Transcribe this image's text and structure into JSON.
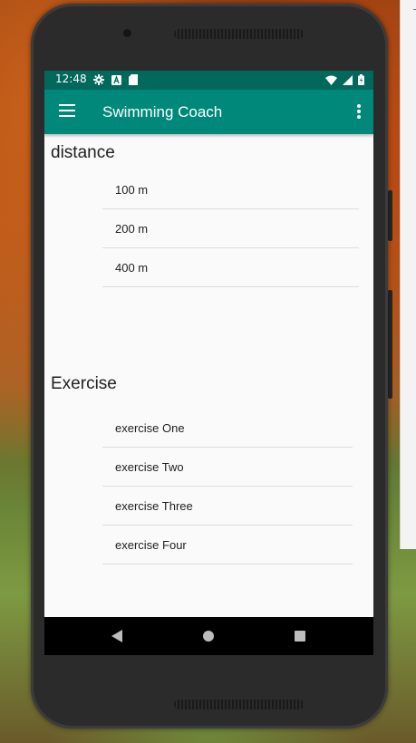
{
  "status_bar": {
    "time": "12:48",
    "left_icons": [
      "gear-icon",
      "a-icon",
      "sd-card-icon"
    ],
    "right_icons": [
      "wifi-icon",
      "signal-icon",
      "battery-icon"
    ]
  },
  "app_bar": {
    "title": "Swimming Coach",
    "color": "#00897b",
    "status_color": "#00695c"
  },
  "distance_section": {
    "title": "distance",
    "items": [
      "100 m",
      "200 m",
      "400 m"
    ]
  },
  "exercise_section": {
    "title": "Exercise",
    "items": [
      "exercise One",
      "exercise Two",
      "exercise Three",
      "exercise Four"
    ]
  },
  "nav_bar": {
    "icons": [
      "back-icon",
      "home-icon",
      "recents-icon"
    ]
  }
}
